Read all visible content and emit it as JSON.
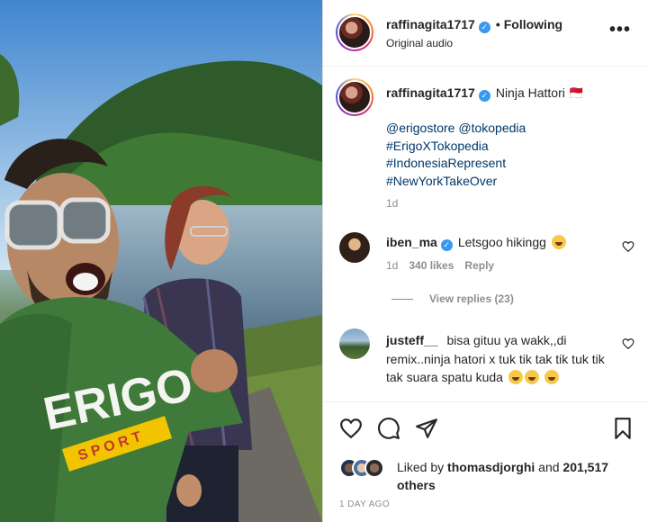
{
  "post": {
    "username": "raffinagita1717",
    "follow_status": "Following",
    "audio": "Original audio",
    "more_label": "•••"
  },
  "caption": {
    "username": "raffinagita1717",
    "text": "Ninja Hattori 🇲🇨",
    "mentions": "@erigostore @tokopedia",
    "hashtags": [
      "#ErigoXTokopedia",
      "#IndonesiaRepresent",
      "#NewYorkTakeOver"
    ],
    "time": "1d"
  },
  "comments": [
    {
      "username": "iben_ma",
      "verified": true,
      "text": "Letsgoo hikingg",
      "time": "1d",
      "likes": "340 likes",
      "reply_label": "Reply",
      "view_replies": "View replies (23)"
    },
    {
      "username": "justeff__",
      "verified": false,
      "text": "bisa gituu ya wakk,,di remix..ninja hatori x tuk tik tak tik tuk tik tak suara spatu kuda"
    }
  ],
  "actions": {
    "liked_by_prefix": "Liked by",
    "liked_by_user": "thomasdjorghi",
    "and": "and",
    "others_count": "201,517 others",
    "time_ago": "1 DAY AGO"
  },
  "icons": {
    "like": "heart-icon",
    "comment": "comment-icon",
    "share": "send-icon",
    "save": "bookmark-icon"
  },
  "colors": {
    "link": "#00376b",
    "verified": "#3897f0",
    "muted": "#8e8e8e"
  }
}
